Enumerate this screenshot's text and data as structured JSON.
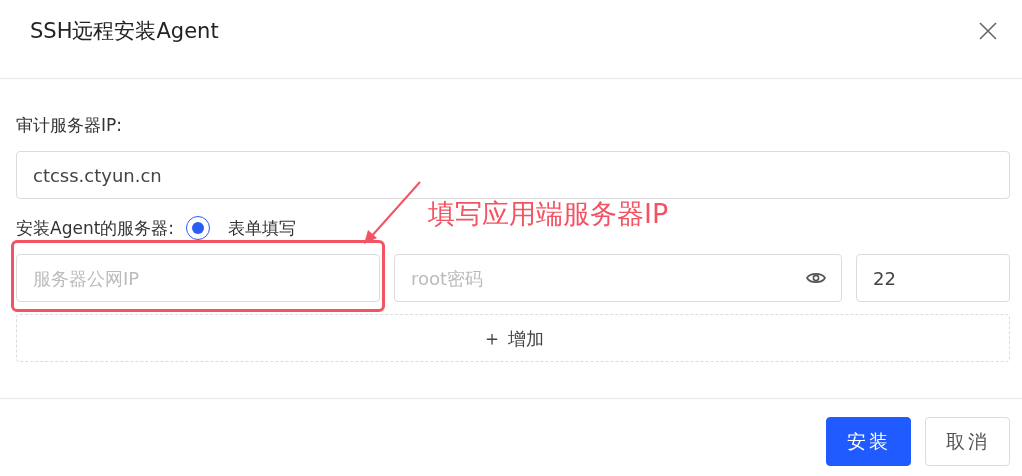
{
  "dialog": {
    "title": "SSH远程安装Agent"
  },
  "audit_server": {
    "label": "审计服务器IP:",
    "value": "ctcss.ctyun.cn"
  },
  "agent_servers": {
    "label": "安装Agent的服务器:",
    "options": [
      {
        "label": "表单填写",
        "selected": true
      }
    ],
    "rows": [
      {
        "ip": {
          "placeholder": "服务器公网IP"
        },
        "password": {
          "placeholder": "root密码"
        },
        "port": {
          "value": "22"
        }
      }
    ],
    "add_button": {
      "icon": "＋",
      "label": "增加"
    }
  },
  "annotation": {
    "text": "填写应用端服务器IP"
  },
  "buttons": [
    {
      "label": "安装",
      "kind": "primary"
    },
    {
      "label": "取消",
      "kind": "default"
    }
  ]
}
